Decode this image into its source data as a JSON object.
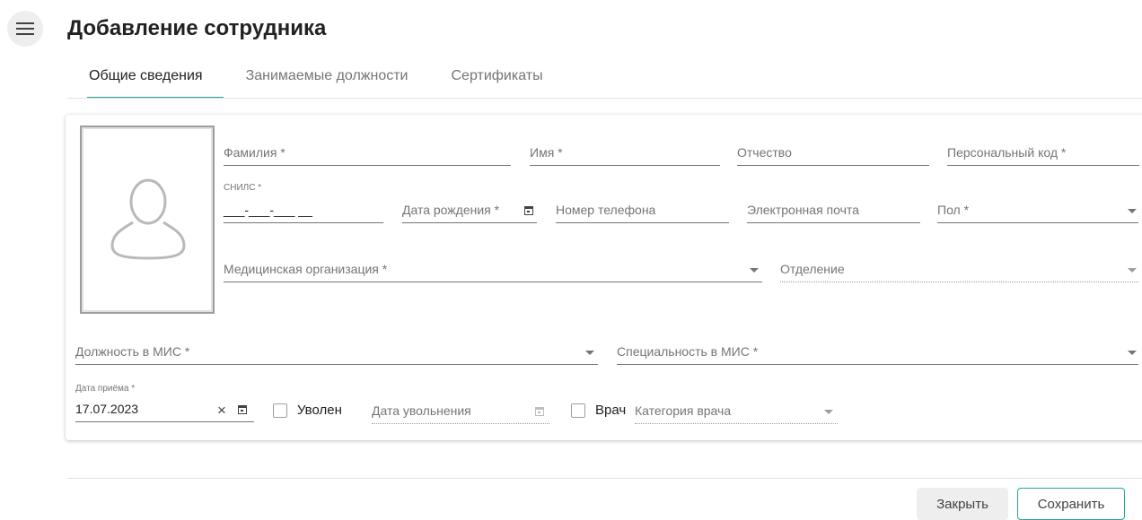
{
  "header": {
    "title": "Добавление сотрудника"
  },
  "tabs": [
    {
      "label": "Общие сведения",
      "active": true
    },
    {
      "label": "Занимаемые должности",
      "active": false
    },
    {
      "label": "Сертификаты",
      "active": false
    }
  ],
  "form": {
    "last_name": {
      "label": "Фамилия *",
      "value": ""
    },
    "first_name": {
      "label": "Имя *",
      "value": ""
    },
    "middle_name": {
      "label": "Отчество",
      "value": ""
    },
    "personal_code": {
      "label": "Персональный код *",
      "value": ""
    },
    "snils": {
      "label": "СНИЛС *",
      "value": "___-___-___ __"
    },
    "birth_date": {
      "label": "Дата рождения *",
      "value": ""
    },
    "phone": {
      "label": "Номер телефона",
      "value": ""
    },
    "email": {
      "label": "Электронная почта",
      "value": ""
    },
    "gender": {
      "label": "Пол *",
      "value": ""
    },
    "med_org": {
      "label": "Медицинская организация *",
      "value": ""
    },
    "department": {
      "label": "Отделение",
      "value": ""
    },
    "position_mis": {
      "label": "Должность в МИС *",
      "value": ""
    },
    "specialty_mis": {
      "label": "Специальность в МИС *",
      "value": ""
    },
    "hire_date": {
      "label": "Дата приёма *",
      "value": "17.07.2023",
      "clear_icon": "×"
    },
    "fired": {
      "label": "Уволен",
      "checked": false
    },
    "fire_date": {
      "label": "Дата увольнения",
      "value": ""
    },
    "doctor": {
      "label": "Врач",
      "checked": false
    },
    "doctor_category": {
      "label": "Категория врача",
      "value": ""
    }
  },
  "footer": {
    "close_label": "Закрыть",
    "save_label": "Сохранить"
  },
  "colors": {
    "accent": "#26a69a"
  }
}
